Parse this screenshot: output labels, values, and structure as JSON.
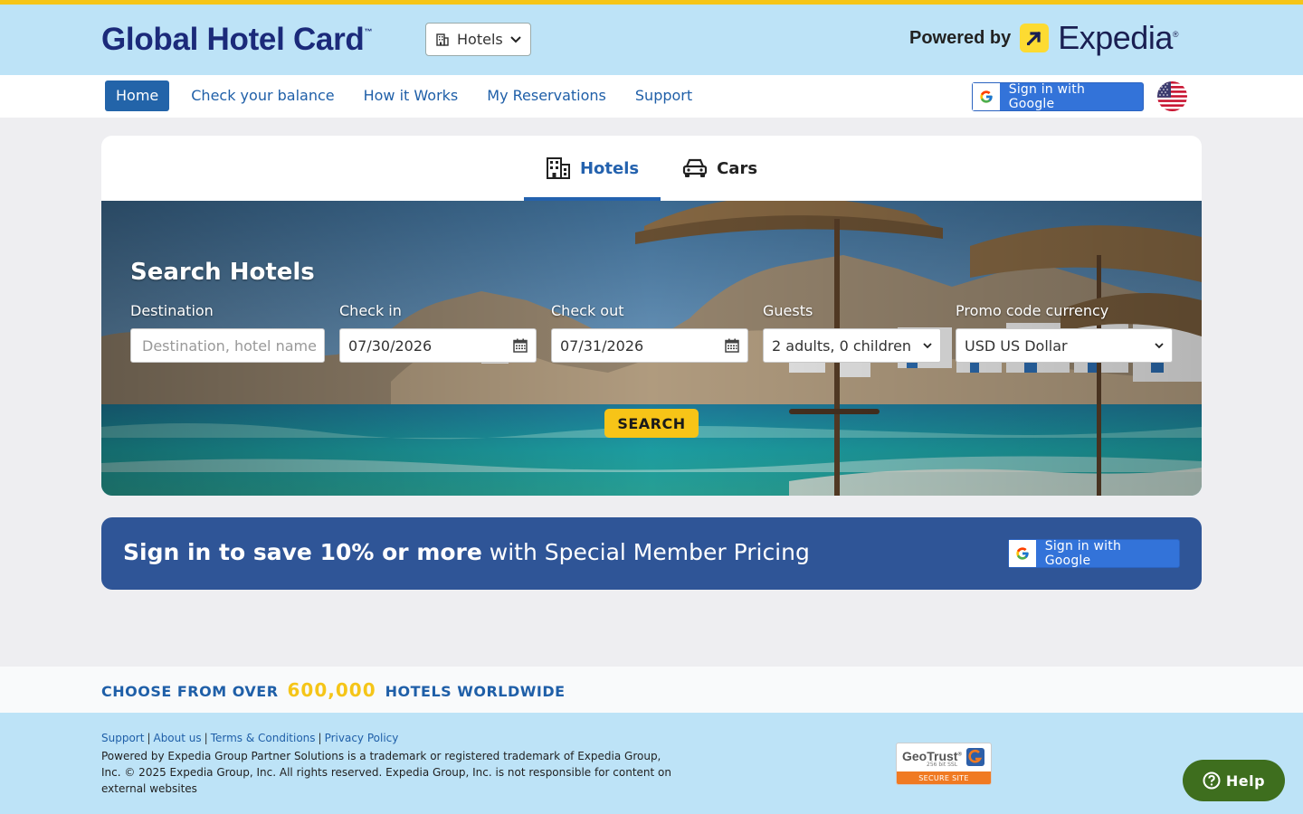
{
  "brand": {
    "name": "Global Hotel Card",
    "trademark": "™"
  },
  "product_select": {
    "value": "Hotels"
  },
  "powered_by": {
    "prefix": "Powered by",
    "partner": "Expedia",
    "partner_suffix": "®"
  },
  "nav": {
    "items": [
      {
        "label": "Home",
        "active": true
      },
      {
        "label": "Check your balance",
        "active": false
      },
      {
        "label": "How it Works",
        "active": false
      },
      {
        "label": "My Reservations",
        "active": false
      },
      {
        "label": "Support",
        "active": false
      }
    ],
    "google_signin": "Sign in with Google"
  },
  "tabs": [
    {
      "label": "Hotels",
      "icon": "building-icon",
      "active": true
    },
    {
      "label": "Cars",
      "icon": "car-icon",
      "active": false
    }
  ],
  "search": {
    "title": "Search Hotels",
    "destination": {
      "label": "Destination",
      "placeholder": "Destination, hotel name"
    },
    "checkin": {
      "label": "Check in",
      "value": "07/30/2026"
    },
    "checkout": {
      "label": "Check out",
      "value": "07/31/2026"
    },
    "guests": {
      "label": "Guests",
      "value": "2 adults, 0 children"
    },
    "currency": {
      "label": "Promo code currency",
      "value": "USD US Dollar"
    },
    "button": "SEARCH"
  },
  "promo": {
    "bold": "Sign in to save 10% or more",
    "rest": " with Special Member Pricing",
    "google_signin": "Sign in with Google"
  },
  "band": {
    "prefix": "CHOOSE FROM OVER",
    "number": "600,000",
    "suffix": "HOTELS WORLDWIDE"
  },
  "footer": {
    "links": [
      "Support",
      "About us",
      "Terms & Conditions",
      "Privacy Policy"
    ],
    "separator": "|",
    "copyright": "Powered by Expedia Group Partner Solutions is a trademark or registered trademark of Expedia Group, Inc. © 2025 Expedia Group, Inc. All rights reserved. Expedia Group, Inc. is not responsible for content on external websites",
    "badge": {
      "name": "GeoTrust",
      "mark": "®",
      "sub": "256 bit SSL",
      "label": "SECURE SITE"
    }
  },
  "help": {
    "label": "Help"
  },
  "colors": {
    "accent_blue": "#2364a9",
    "header_bg": "#bde3f7",
    "yellow": "#f5c518",
    "promo_bg": "#2f5597",
    "help_green": "#3e6e1e"
  }
}
